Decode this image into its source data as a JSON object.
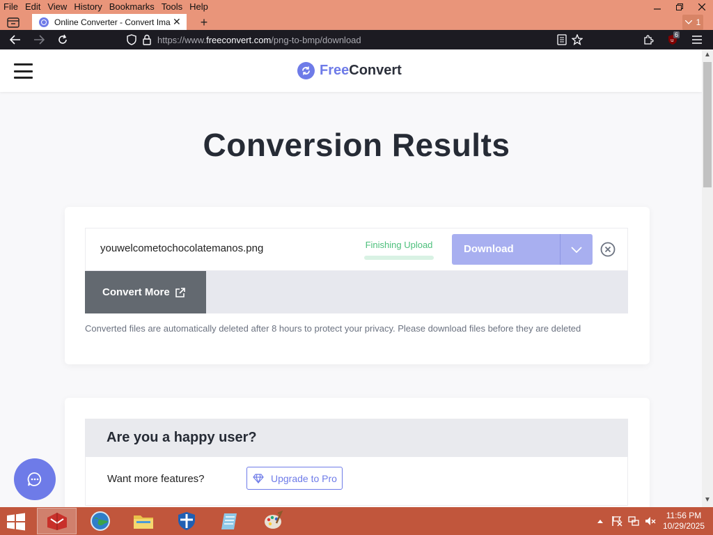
{
  "menubar": {
    "items": [
      "File",
      "Edit",
      "View",
      "History",
      "Bookmarks",
      "Tools",
      "Help"
    ]
  },
  "tab": {
    "title": "Online Converter - Convert Ima",
    "close": "✕"
  },
  "tab_list_count": "1",
  "url": {
    "prefix": "https://www.",
    "host": "freeconvert.com",
    "path": "/png-to-bmp/download"
  },
  "ublock_count": "6",
  "logo": {
    "free": "Free",
    "convert": "Convert"
  },
  "page_title": "Conversion Results",
  "file": {
    "name": "youwelcometochocolatemanos.png",
    "status": "Finishing Upload",
    "progress": 0.0,
    "download_label": "Download"
  },
  "convert_more_label": "Convert More",
  "privacy_note": "Converted files are automatically deleted after 8 hours to protect your privacy. Please download files before they are deleted",
  "happy": {
    "title": "Are you a happy user?",
    "features_label": "Want more features?",
    "upgrade_label": "Upgrade to Pro"
  },
  "clock": {
    "time": "11:56 PM",
    "date": "10/29/2025"
  },
  "colors": {
    "brand": "#6e7be8",
    "taskbar": "#c1563c",
    "titlebar": "#e9957a"
  }
}
